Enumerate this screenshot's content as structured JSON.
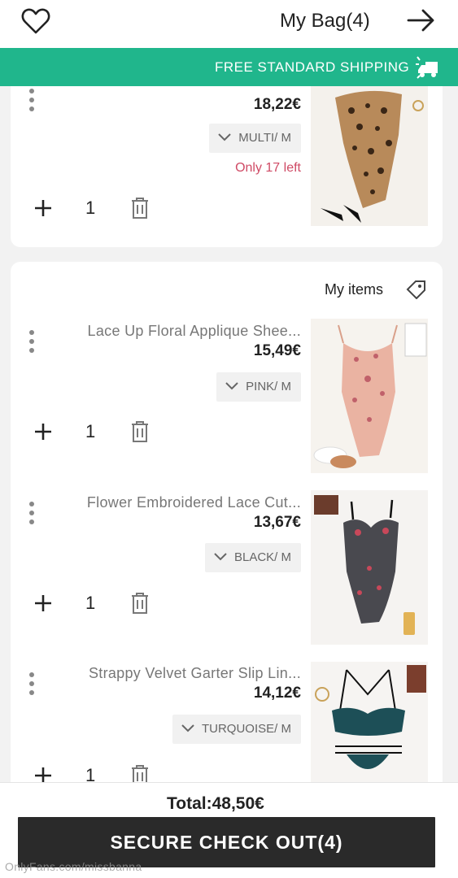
{
  "header": {
    "title": "My Bag(4)",
    "heart_icon": "heart-icon",
    "forward_icon": "arrow-right-icon"
  },
  "banner": {
    "text": "FREE STANDARD SHIPPING",
    "icon": "truck-icon",
    "color": "#20b68c"
  },
  "first_item": {
    "price": "18,22€",
    "size": "MULTI/ M",
    "stock": "Only 17 left",
    "quantity": "1"
  },
  "section": {
    "label": "My items",
    "icon": "tag-icon"
  },
  "items": [
    {
      "name": "Lace Up Floral Applique Shee...",
      "price": "15,49€",
      "size": "PINK/ M",
      "quantity": "1"
    },
    {
      "name": "Flower Embroidered Lace Cut...",
      "price": "13,67€",
      "size": "BLACK/ M",
      "quantity": "1"
    },
    {
      "name": "Strappy Velvet Garter Slip Lin...",
      "price": "14,12€",
      "size": "TURQUOISE/ M",
      "quantity": "1"
    }
  ],
  "footer": {
    "total": "Total:48,50€",
    "checkout": "SECURE CHECK OUT(4)",
    "watermark": "OnlyFans.com/missbanna"
  },
  "colors": {
    "accent": "#20b68c",
    "stock_warning": "#cf4a65",
    "checkout_bg": "#2a2a2a"
  }
}
